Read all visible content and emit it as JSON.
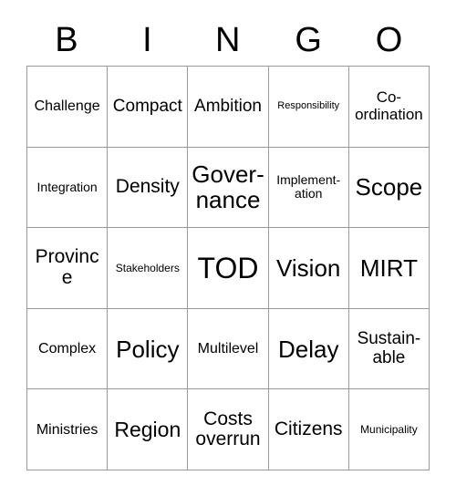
{
  "card": {
    "header_letters": [
      "B",
      "I",
      "N",
      "G",
      "O"
    ],
    "columns": 5,
    "rows": 5,
    "grid_border_color": "#9a9a9a",
    "background_color": "#ffffff",
    "text_color": "#000000",
    "cells": [
      [
        {
          "label": "Challenge",
          "size": "fs-lg"
        },
        {
          "label": "Compact",
          "size": "fs-2xl"
        },
        {
          "label": "Ambition",
          "size": "fs-2xl"
        },
        {
          "label": "Responsibility",
          "size": "fs-xs"
        },
        {
          "label": "Co-ordination",
          "size": "fs-xl"
        }
      ],
      [
        {
          "label": "Integration",
          "size": "fs-md"
        },
        {
          "label": "Density",
          "size": "fs-3xl"
        },
        {
          "label": "Governance",
          "size": "fs-5xl"
        },
        {
          "label": "Implementation",
          "size": "fs-md"
        },
        {
          "label": "Scope",
          "size": "fs-5xl"
        }
      ],
      [
        {
          "label": "Province",
          "size": "fs-3xl"
        },
        {
          "label": "Stakeholders",
          "size": "fs-sm"
        },
        {
          "label": "TOD",
          "size": "fs-6xl"
        },
        {
          "label": "Vision",
          "size": "fs-5xl"
        },
        {
          "label": "MIRT",
          "size": "fs-5xl"
        }
      ],
      [
        {
          "label": "Complex",
          "size": "fs-lg"
        },
        {
          "label": "Policy",
          "size": "fs-5xl"
        },
        {
          "label": "Multilevel",
          "size": "fs-lg"
        },
        {
          "label": "Delay",
          "size": "fs-5xl"
        },
        {
          "label": "Sustainable",
          "size": "fs-2xl"
        }
      ],
      [
        {
          "label": "Ministries",
          "size": "fs-lg"
        },
        {
          "label": "Region",
          "size": "fs-4xl"
        },
        {
          "label": "Costs overrun",
          "size": "fs-3xl"
        },
        {
          "label": "Citizens",
          "size": "fs-3xl"
        },
        {
          "label": "Municipality",
          "size": "fs-sm"
        }
      ]
    ]
  }
}
